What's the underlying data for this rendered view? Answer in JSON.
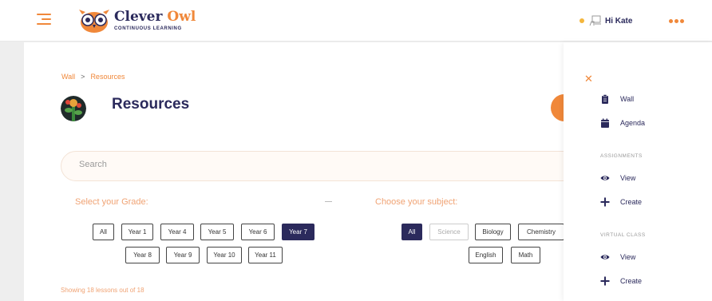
{
  "header": {
    "brand_main": "Clever",
    "brand_accent": "Owl",
    "brand_sub": "CONTINUOUS LEARNING",
    "greeting": "Hi Kate"
  },
  "breadcrumb": {
    "items": [
      "Wall",
      "Resources"
    ],
    "separator": ">"
  },
  "page": {
    "title": "Resources"
  },
  "search": {
    "placeholder": "Search",
    "value": ""
  },
  "grade": {
    "label": "Select your Grade:",
    "options": [
      "All",
      "Year 1",
      "Year 4",
      "Year 5",
      "Year 6",
      "Year 7",
      "Year 8",
      "Year 9",
      "Year 10",
      "Year 11"
    ],
    "selected": "Year 7"
  },
  "subject": {
    "label": "Choose your subject:",
    "options": [
      "All",
      "Science",
      "Biology",
      "Chemistry",
      "English",
      "Math"
    ],
    "selected": "All"
  },
  "results": {
    "showing_text": "Showing 18 lessons out of 18"
  },
  "side_menu": {
    "items_top": [
      {
        "label": "Wall",
        "icon": "clipboard-icon"
      },
      {
        "label": "Agenda",
        "icon": "calendar-icon"
      }
    ],
    "assignments_heading": "ASSIGNMENTS",
    "assignments": [
      {
        "label": "View",
        "icon": "eye-icon"
      },
      {
        "label": "Create",
        "icon": "plus-icon"
      }
    ],
    "virtual_class_heading": "VIRTUAL CLASS",
    "virtual_class": [
      {
        "label": "View",
        "icon": "eye-icon"
      },
      {
        "label": "Create",
        "icon": "plus-icon"
      }
    ]
  },
  "colors": {
    "accent": "#f0883a",
    "navy": "#2b2a5c",
    "status": "#f4b63c"
  }
}
